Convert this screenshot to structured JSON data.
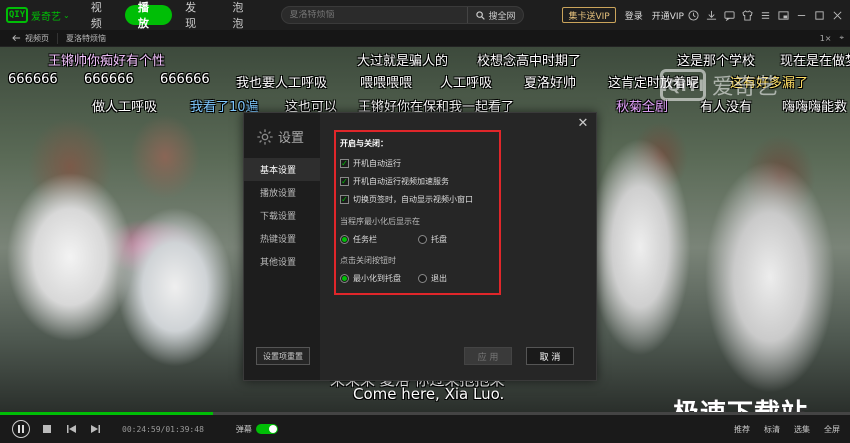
{
  "app": {
    "logo_box": "QIY",
    "logo_text": "爱奇艺",
    "logo_caret": "⌄"
  },
  "nav": [
    {
      "label": "视频",
      "active": false
    },
    {
      "label": "播放",
      "active": true
    },
    {
      "label": "发现",
      "active": false
    },
    {
      "label": "泡泡",
      "active": false
    }
  ],
  "search": {
    "placeholder": "夏洛特烦恼",
    "button_label": "搜全网"
  },
  "header_links": {
    "vip_badge": "集卡送VIP",
    "login": "登录",
    "open_vip": "开通VIP"
  },
  "breadcrumb": {
    "back": "视频页",
    "current": "夏洛特烦恼",
    "scale": "1×",
    "pin": "⌖"
  },
  "danmaku": [
    {
      "text": "王锵帅你痴好有个性",
      "color": "#f5c4ff"
    },
    {
      "text": "大过就是骗人的",
      "color": "#ffffff"
    },
    {
      "text": "校想念高中时期了",
      "color": "#ffffff"
    },
    {
      "text": "这是那个学校",
      "color": "#ffffff"
    },
    {
      "text": "现在是在做梦过去的",
      "color": "#ffffff"
    },
    {
      "text": "666666",
      "color": "#ffffff"
    },
    {
      "text": "666666",
      "color": "#ffffff"
    },
    {
      "text": "666666",
      "color": "#ffffff"
    },
    {
      "text": "我也要人工呼吸",
      "color": "#ffffff"
    },
    {
      "text": "喂喂喂喂",
      "color": "#ffffff"
    },
    {
      "text": "人工呼吸",
      "color": "#ffffff"
    },
    {
      "text": "夏洛好帅",
      "color": "#ffffff"
    },
    {
      "text": "这肯定时放着呢",
      "color": "#ffffff"
    },
    {
      "text": "这有好多漏了",
      "color": "#ffe066"
    },
    {
      "text": "做人工呼吸",
      "color": "#ffffff"
    },
    {
      "text": "我看了10遍",
      "color": "#7ec8ff"
    },
    {
      "text": "这也可以",
      "color": "#ffffff"
    },
    {
      "text": "王锵好你在保和我一起看了",
      "color": "#ffffff"
    },
    {
      "text": "秋菊全剧",
      "color": "#e6a4ff"
    },
    {
      "text": "有人没有",
      "color": "#ffffff"
    },
    {
      "text": "嗨嗨嗨能救",
      "color": "#ffffff"
    }
  ],
  "watermark": {
    "box": "iQIYI",
    "text": "爱奇艺"
  },
  "subtitles": {
    "cn": "来来来 夏洛 你过来抱抱来",
    "en": "Come here, Xia Luo."
  },
  "site_mark": "极速下载站",
  "dialog": {
    "title": "设置",
    "menu": [
      {
        "label": "基本设置",
        "active": true
      },
      {
        "label": "播放设置",
        "active": false
      },
      {
        "label": "下载设置",
        "active": false
      },
      {
        "label": "热键设置",
        "active": false
      },
      {
        "label": "其他设置",
        "active": false
      }
    ],
    "reset_label": "设置项重置",
    "section_title": "开启与关闭：",
    "checkboxes": [
      {
        "label": "开机自动运行",
        "checked": true
      },
      {
        "label": "开机自动运行视频加速服务",
        "checked": true
      },
      {
        "label": "切换页签时，自动显示视频小窗口",
        "checked": true
      }
    ],
    "minimize_label": "当程序最小化后显示在",
    "minimize_options": [
      {
        "label": "任务栏",
        "selected": true
      },
      {
        "label": "托盘",
        "selected": false
      }
    ],
    "close_label": "点击关闭按钮时",
    "close_options": [
      {
        "label": "最小化到托盘",
        "selected": true
      },
      {
        "label": "退出",
        "selected": false
      }
    ],
    "apply_label": "应 用",
    "cancel_label": "取 消",
    "close_icon": "✕"
  },
  "player": {
    "time": "00:24:59/01:39:48",
    "danmaku_label": "弹幕",
    "progress": 0.25,
    "right_items": [
      "推荐",
      "标清",
      "选集",
      "全屏"
    ]
  },
  "colors": {
    "accent": "#00be06",
    "highlight_box": "#e0262a"
  }
}
